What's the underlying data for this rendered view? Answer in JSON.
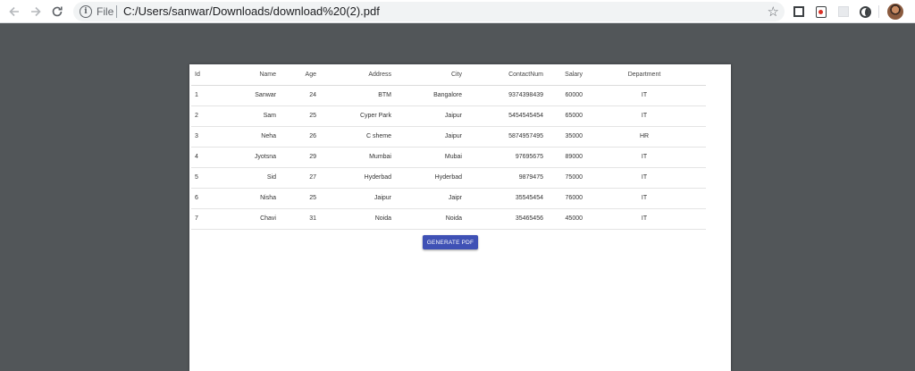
{
  "browser": {
    "scheme_label": "File",
    "url": "C:/Users/sanwar/Downloads/download%20(2).pdf"
  },
  "table": {
    "headers": {
      "id": "Id",
      "name": "Name",
      "age": "Age",
      "address": "Address",
      "city": "City",
      "contact": "ContactNum",
      "salary": "Salary",
      "department": "Department"
    },
    "rows": [
      {
        "id": "1",
        "name": "Sanwar",
        "age": "24",
        "address": "BTM",
        "city": "Bangalore",
        "contact": "9374398439",
        "salary": "60000",
        "department": "IT"
      },
      {
        "id": "2",
        "name": "Sam",
        "age": "25",
        "address": "Cyper Park",
        "city": "Jaipur",
        "contact": "5454545454",
        "salary": "65000",
        "department": "IT"
      },
      {
        "id": "3",
        "name": "Neha",
        "age": "26",
        "address": "C sheme",
        "city": "Jaipur",
        "contact": "5874957495",
        "salary": "35000",
        "department": "HR"
      },
      {
        "id": "4",
        "name": "Jyotsna",
        "age": "29",
        "address": "Mumbai",
        "city": "Mubai",
        "contact": "97695675",
        "salary": "89000",
        "department": "IT"
      },
      {
        "id": "5",
        "name": "Sid",
        "age": "27",
        "address": "Hyderbad",
        "city": "Hyderbad",
        "contact": "9879475",
        "salary": "75000",
        "department": "IT"
      },
      {
        "id": "6",
        "name": "Nisha",
        "age": "25",
        "address": "Jaipur",
        "city": "Jaipr",
        "contact": "35545454",
        "salary": "76000",
        "department": "IT"
      },
      {
        "id": "7",
        "name": "Chavi",
        "age": "31",
        "address": "Noida",
        "city": "Noida",
        "contact": "35465456",
        "salary": "45000",
        "department": "IT"
      }
    ]
  },
  "actions": {
    "generate_label": "GENERATE PDF"
  },
  "colors": {
    "viewer_background": "#525659",
    "button_primary": "#3f51b5"
  }
}
